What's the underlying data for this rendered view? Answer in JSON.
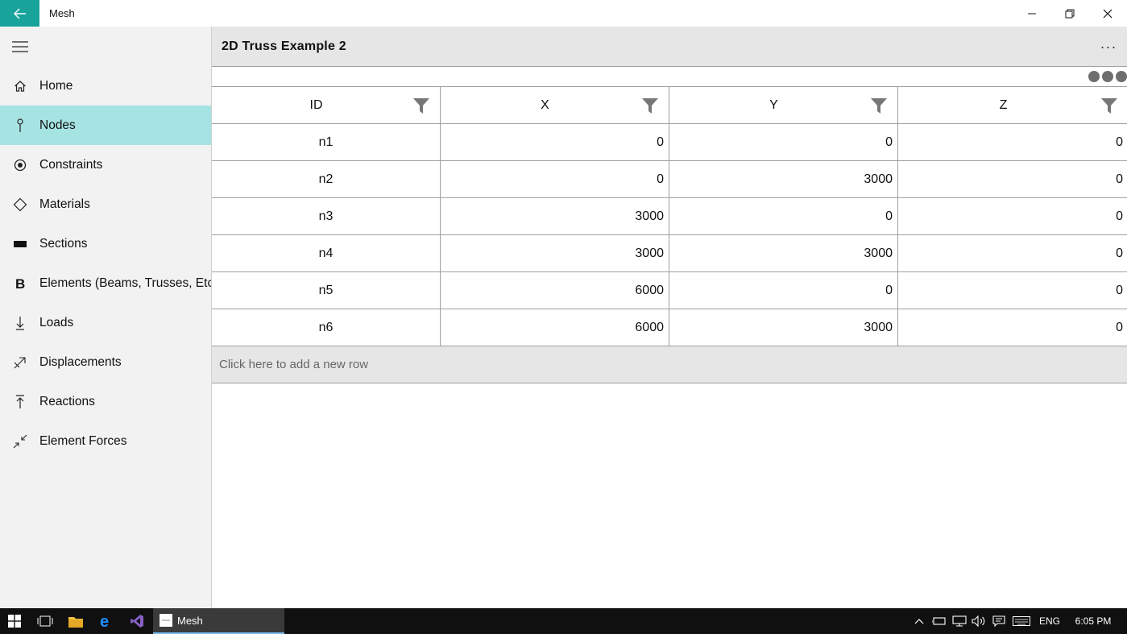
{
  "window": {
    "title": "Mesh"
  },
  "sidebar": {
    "items": [
      {
        "label": "Home",
        "icon": "home-icon"
      },
      {
        "label": "Nodes",
        "icon": "pin-icon",
        "active": true
      },
      {
        "label": "Constraints",
        "icon": "target-icon"
      },
      {
        "label": "Materials",
        "icon": "diamond-icon"
      },
      {
        "label": "Sections",
        "icon": "rectangle-icon"
      },
      {
        "label": "Elements (Beams, Trusses, Etc.)",
        "icon": "bold-b-icon"
      },
      {
        "label": "Loads",
        "icon": "arrow-down-to-line-icon"
      },
      {
        "label": "Displacements",
        "icon": "displacement-icon"
      },
      {
        "label": "Reactions",
        "icon": "arrow-up-from-line-icon"
      },
      {
        "label": "Element Forces",
        "icon": "compress-arrows-icon"
      }
    ],
    "accent": "#a6e3e3"
  },
  "page": {
    "title": "2D Truss Example 2",
    "more_label": "···"
  },
  "grid": {
    "columns": [
      "ID",
      "X",
      "Y",
      "Z"
    ],
    "rows": [
      {
        "id": "n1",
        "x": "0",
        "y": "0",
        "z": "0"
      },
      {
        "id": "n2",
        "x": "0",
        "y": "3000",
        "z": "0"
      },
      {
        "id": "n3",
        "x": "3000",
        "y": "0",
        "z": "0"
      },
      {
        "id": "n4",
        "x": "3000",
        "y": "3000",
        "z": "0"
      },
      {
        "id": "n5",
        "x": "6000",
        "y": "0",
        "z": "0"
      },
      {
        "id": "n6",
        "x": "6000",
        "y": "3000",
        "z": "0"
      }
    ],
    "add_row_text": "Click here to add a new row"
  },
  "taskbar": {
    "active_app": "Mesh",
    "language": "ENG",
    "time": "6:05 PM"
  },
  "colors": {
    "accent": "#18a39b",
    "selected_nav": "#a6e3e3"
  }
}
